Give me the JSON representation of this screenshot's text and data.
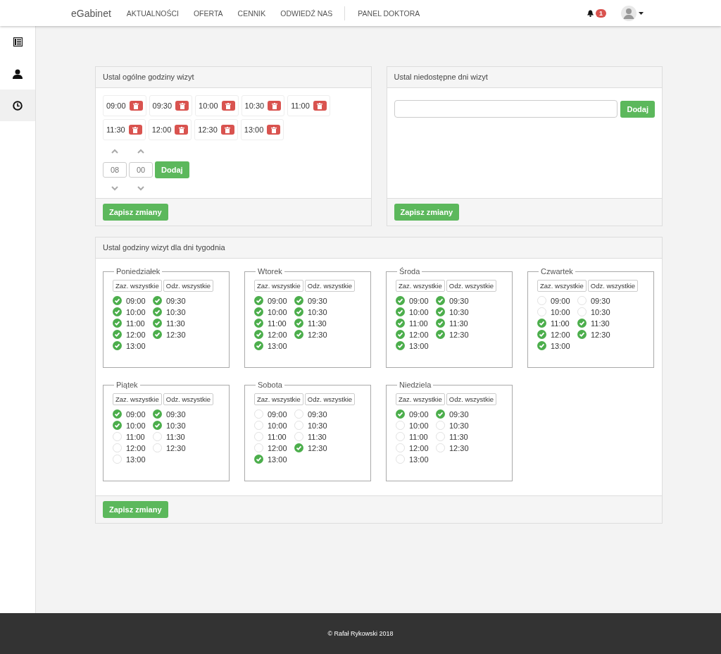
{
  "navbar": {
    "brand": "eGabinet",
    "links": [
      "AKTUALNOŚCI",
      "OFERTA",
      "CENNIK",
      "ODWIEDŹ NAS"
    ],
    "panel_link": "PANEL DOKTORA",
    "notification_count": "1"
  },
  "sidebar": {
    "items": [
      {
        "selected": false
      },
      {
        "selected": false
      },
      {
        "selected": true
      }
    ]
  },
  "general_hours": {
    "title": "Ustal ogólne godziny wizyt",
    "hours": [
      "09:00",
      "09:30",
      "10:00",
      "10:30",
      "11:00",
      "11:30",
      "12:00",
      "12:30",
      "13:00"
    ],
    "hour_value": "08",
    "minute_value": "00",
    "add_button": "Dodaj",
    "save_button": "Zapisz zmiany"
  },
  "unavailable_days": {
    "title": "Ustal niedostępne dni wizyt",
    "add_button": "Dodaj",
    "save_button": "Zapisz zmiany"
  },
  "weekly_hours": {
    "title": "Ustal godziny wizyt dla dni tygodnia",
    "save_button": "Zapisz zmiany",
    "days": [
      {
        "name": "Poniedziałek",
        "select_all": "Zaz. wszystkie",
        "deselect_all": "Odz. wszystkie",
        "slots": [
          {
            "time": "09:00",
            "checked": true
          },
          {
            "time": "09:30",
            "checked": true
          },
          {
            "time": "10:00",
            "checked": true
          },
          {
            "time": "10:30",
            "checked": true
          },
          {
            "time": "11:00",
            "checked": true
          },
          {
            "time": "11:30",
            "checked": true
          },
          {
            "time": "12:00",
            "checked": true
          },
          {
            "time": "12:30",
            "checked": true
          },
          {
            "time": "13:00",
            "checked": true
          }
        ]
      },
      {
        "name": "Wtorek",
        "select_all": "Zaz. wszystkie",
        "deselect_all": "Odz. wszystkie",
        "slots": [
          {
            "time": "09:00",
            "checked": true
          },
          {
            "time": "09:30",
            "checked": true
          },
          {
            "time": "10:00",
            "checked": true
          },
          {
            "time": "10:30",
            "checked": true
          },
          {
            "time": "11:00",
            "checked": true
          },
          {
            "time": "11:30",
            "checked": true
          },
          {
            "time": "12:00",
            "checked": true
          },
          {
            "time": "12:30",
            "checked": true
          },
          {
            "time": "13:00",
            "checked": true
          }
        ]
      },
      {
        "name": "Środa",
        "select_all": "Zaz. wszystkie",
        "deselect_all": "Odz. wszystkie",
        "slots": [
          {
            "time": "09:00",
            "checked": true
          },
          {
            "time": "09:30",
            "checked": true
          },
          {
            "time": "10:00",
            "checked": true
          },
          {
            "time": "10:30",
            "checked": true
          },
          {
            "time": "11:00",
            "checked": true
          },
          {
            "time": "11:30",
            "checked": true
          },
          {
            "time": "12:00",
            "checked": true
          },
          {
            "time": "12:30",
            "checked": true
          },
          {
            "time": "13:00",
            "checked": true
          }
        ]
      },
      {
        "name": "Czwartek",
        "select_all": "Zaz. wszystkie",
        "deselect_all": "Odz. wszystkie",
        "slots": [
          {
            "time": "09:00",
            "checked": false
          },
          {
            "time": "09:30",
            "checked": false
          },
          {
            "time": "10:00",
            "checked": false
          },
          {
            "time": "10:30",
            "checked": false
          },
          {
            "time": "11:00",
            "checked": true
          },
          {
            "time": "11:30",
            "checked": true
          },
          {
            "time": "12:00",
            "checked": true
          },
          {
            "time": "12:30",
            "checked": true
          },
          {
            "time": "13:00",
            "checked": true
          }
        ]
      },
      {
        "name": "Piątek",
        "select_all": "Zaz. wszystkie",
        "deselect_all": "Odz. wszystkie",
        "slots": [
          {
            "time": "09:00",
            "checked": true
          },
          {
            "time": "09:30",
            "checked": true
          },
          {
            "time": "10:00",
            "checked": true
          },
          {
            "time": "10:30",
            "checked": true
          },
          {
            "time": "11:00",
            "checked": false
          },
          {
            "time": "11:30",
            "checked": false
          },
          {
            "time": "12:00",
            "checked": false
          },
          {
            "time": "12:30",
            "checked": false
          },
          {
            "time": "13:00",
            "checked": false
          }
        ]
      },
      {
        "name": "Sobota",
        "select_all": "Zaz. wszystkie",
        "deselect_all": "Odz. wszystkie",
        "slots": [
          {
            "time": "09:00",
            "checked": false
          },
          {
            "time": "09:30",
            "checked": false
          },
          {
            "time": "10:00",
            "checked": false
          },
          {
            "time": "10:30",
            "checked": false
          },
          {
            "time": "11:00",
            "checked": false
          },
          {
            "time": "11:30",
            "checked": false
          },
          {
            "time": "12:00",
            "checked": false
          },
          {
            "time": "12:30",
            "checked": true
          },
          {
            "time": "13:00",
            "checked": true
          }
        ]
      },
      {
        "name": "Niedziela",
        "select_all": "Zaz. wszystkie",
        "deselect_all": "Odz. wszystkie",
        "slots": [
          {
            "time": "09:00",
            "checked": true
          },
          {
            "time": "09:30",
            "checked": true
          },
          {
            "time": "10:00",
            "checked": false
          },
          {
            "time": "10:30",
            "checked": false
          },
          {
            "time": "11:00",
            "checked": false
          },
          {
            "time": "11:30",
            "checked": false
          },
          {
            "time": "12:00",
            "checked": false
          },
          {
            "time": "12:30",
            "checked": false
          },
          {
            "time": "13:00",
            "checked": false
          }
        ]
      }
    ]
  },
  "footer": {
    "text": "© Rafał Rykowski 2018"
  }
}
